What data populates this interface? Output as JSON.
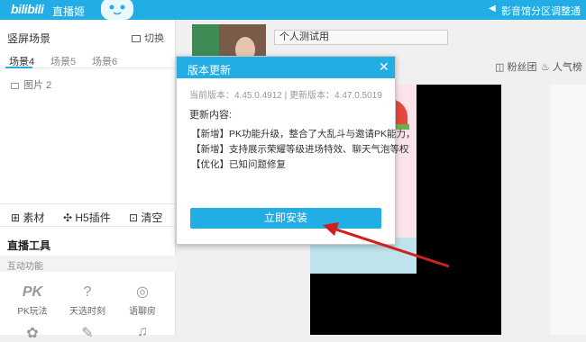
{
  "topbar": {
    "logo": "bilibili",
    "subtitle": "直播姬",
    "notice": "影音馆分区调整通"
  },
  "left": {
    "scene_title": "竖屏场景",
    "switch_label": "切换",
    "tabs": [
      "场景4",
      "场景5",
      "场景6"
    ],
    "source": "图片 2",
    "toolbar": {
      "material": "素材",
      "h5": "H5插件",
      "clear": "清空"
    },
    "tools_title": "直播工具",
    "interact_label": "互动功能",
    "tools": [
      {
        "label": "PK玩法",
        "icon": "PK"
      },
      {
        "label": "天选时刻",
        "icon": "?"
      },
      {
        "label": "语聊房",
        "icon": "◎"
      }
    ]
  },
  "main": {
    "room_title": "个人测试用",
    "fans_label": "粉丝团",
    "popularity_label": "人气榜"
  },
  "dialog": {
    "title": "版本更新",
    "close": "✕",
    "version_line": "当前版本：4.45.0.4912 | 更新版本：4.47.0.5019",
    "update_label": "更新内容:",
    "lines": [
      "【新增】PK功能升级，整合了大乱斗与邀请PK能力，",
      "【新增】支持展示荣耀等级进场特效、聊天气泡等权",
      "【优化】已知问题修复"
    ],
    "install_label": "立即安装"
  },
  "colors": {
    "accent": "#23ade5",
    "arrow": "#d11f1f"
  }
}
